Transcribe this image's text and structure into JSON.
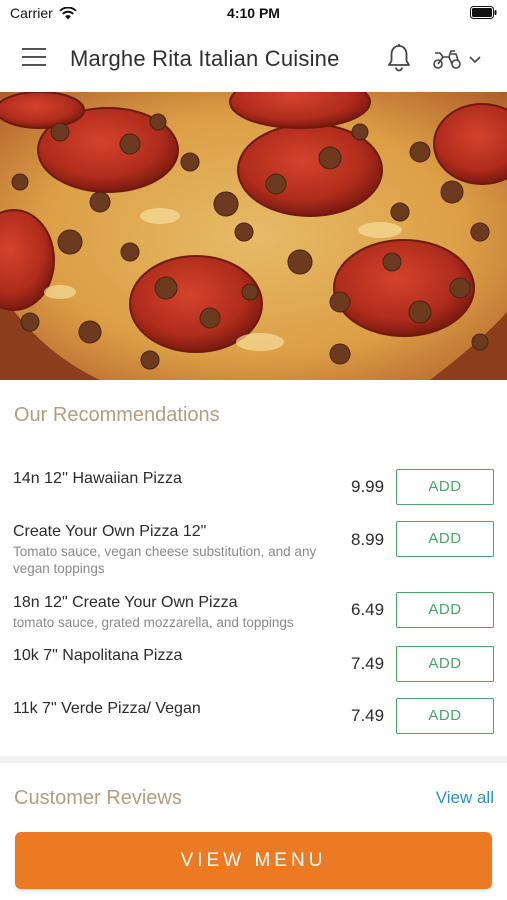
{
  "status_bar": {
    "carrier": "Carrier",
    "time": "4:10 PM",
    "icons": [
      "wifi-icon",
      "battery-icon"
    ]
  },
  "header": {
    "title": "Marghe Rita Italian Cuisine",
    "icons": [
      "hamburger-menu-icon",
      "bell-icon",
      "scooter-icon",
      "chevron-down-icon"
    ]
  },
  "hero": {
    "subject": "pepperoni-sausage-pizza-photo"
  },
  "recommendations": {
    "title": "Our Recommendations",
    "items": [
      {
        "name": "14n 12'' Hawaiian Pizza",
        "description": "",
        "price": "9.99",
        "button": "ADD"
      },
      {
        "name": "Create Your Own Pizza 12\"",
        "description": "Tomato sauce, vegan cheese substitution, and any vegan toppings",
        "price": "8.99",
        "button": "ADD"
      },
      {
        "name": "18n 12\" Create Your Own Pizza",
        "description": "tomato sauce, grated mozzarella, and toppings",
        "price": "6.49",
        "button": "ADD"
      },
      {
        "name": "10k 7\" Napolitana Pizza",
        "description": "",
        "price": "7.49",
        "button": "ADD"
      },
      {
        "name": "11k 7\" Verde Pizza/ Vegan",
        "description": "",
        "price": "7.49",
        "button": "ADD"
      }
    ]
  },
  "reviews": {
    "title": "Customer Reviews",
    "view_all": "View all"
  },
  "cta": {
    "label": "VIEW MENU"
  },
  "colors": {
    "accent_orange": "#ec7a23",
    "add_green": "#4aa46a",
    "section_title": "#b29e80",
    "link_blue": "#2f8fbf"
  }
}
